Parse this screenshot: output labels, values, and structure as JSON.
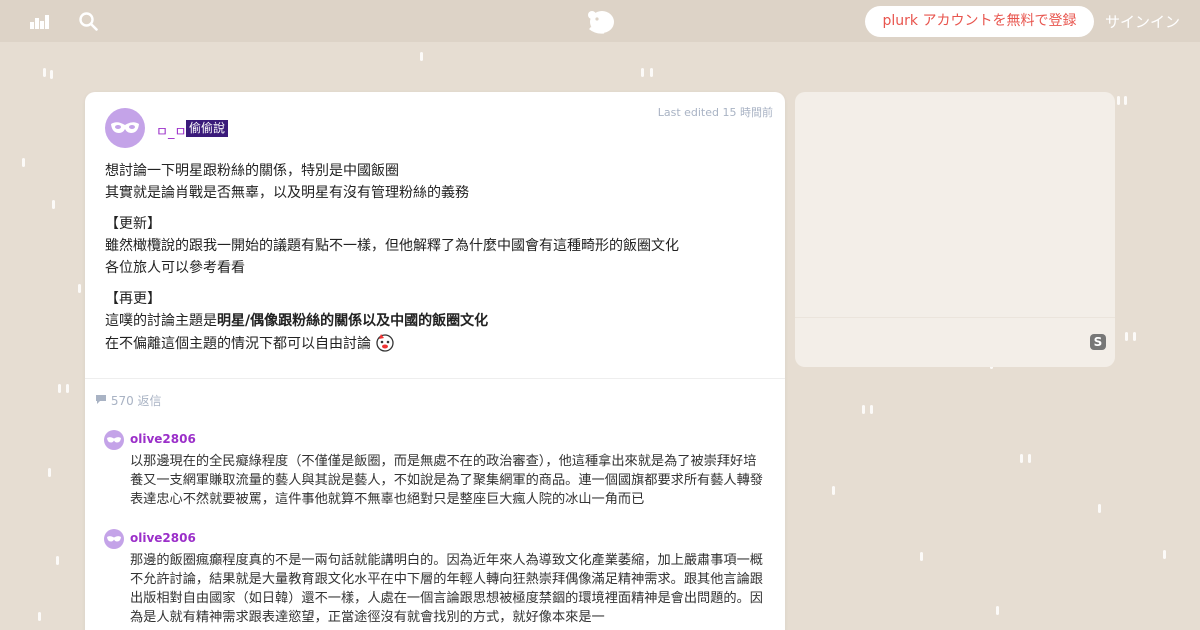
{
  "topbar": {
    "signup_label": "plurk アカウントを無料で登録",
    "signin_label": "サインイン",
    "icons": [
      "stats-icon",
      "search-icon",
      "plurk-logo-icon"
    ]
  },
  "plurk": {
    "owner_name": "ㅁ_ㅁ",
    "qualifier": "偷偷說",
    "edited": "Last edited 15 時間前",
    "lines": [
      "想討論一下明星跟粉絲的關係，特別是中國飯圈",
      "其實就是論肖戰是否無辜，以及明星有沒有管理粉絲的義務",
      "【更新】",
      "雖然橄欖說的跟我一開始的議題有點不一樣，但他解釋了為什麼中國會有這種畸形的飯圈文化",
      "各位旅人可以參考看看",
      "【再更】",
      "這噗的討論主題是",
      "明星/偶像跟粉絲的關係以及中國的飯圈文化",
      "在不偏離這個主題的情況下都可以自由討論"
    ],
    "reply_count": "570 返信"
  },
  "responses": [
    {
      "name": "olive2806",
      "text": "以那邊現在的全民癡綠程度（不僅僅是飯圈，而是無處不在的政治審查），他這種拿出來就是為了被崇拜好培養又一支網軍賺取流量的藝人與其說是藝人，不如說是為了聚集網軍的商品。連一個國旗都要求所有藝人轉發表達忠心不然就要被罵，這件事他就算不無辜也絕對只是整座巨大瘋人院的冰山一角而已"
    },
    {
      "name": "olive2806",
      "text": "那邊的飯圈瘋癲程度真的不是一兩句話就能講明白的。因為近年來人為導致文化產業萎縮，加上嚴肅事項一概不允許討論，結果就是大量教育跟文化水平在中下層的年輕人轉向狂熱崇拜偶像滿足精神需求。跟其他言論跟出版相對自由國家（如日韓）還不一樣，人處在一個言論跟思想被極度禁錮的環境裡面精神是會出問題的。因為是人就有精神需求跟表達慾望，正當途徑沒有就會找別的方式，就好像本來是一"
    }
  ],
  "side_panel": {
    "logo_icon": "S"
  },
  "colors": {
    "background": "#e6ddd2",
    "topbar": "#ddd3c7",
    "accent": "#e8554e",
    "username": "#9b2fc9",
    "qualifier_bg": "#3a1a7a",
    "muted": "#a9b3c4"
  }
}
